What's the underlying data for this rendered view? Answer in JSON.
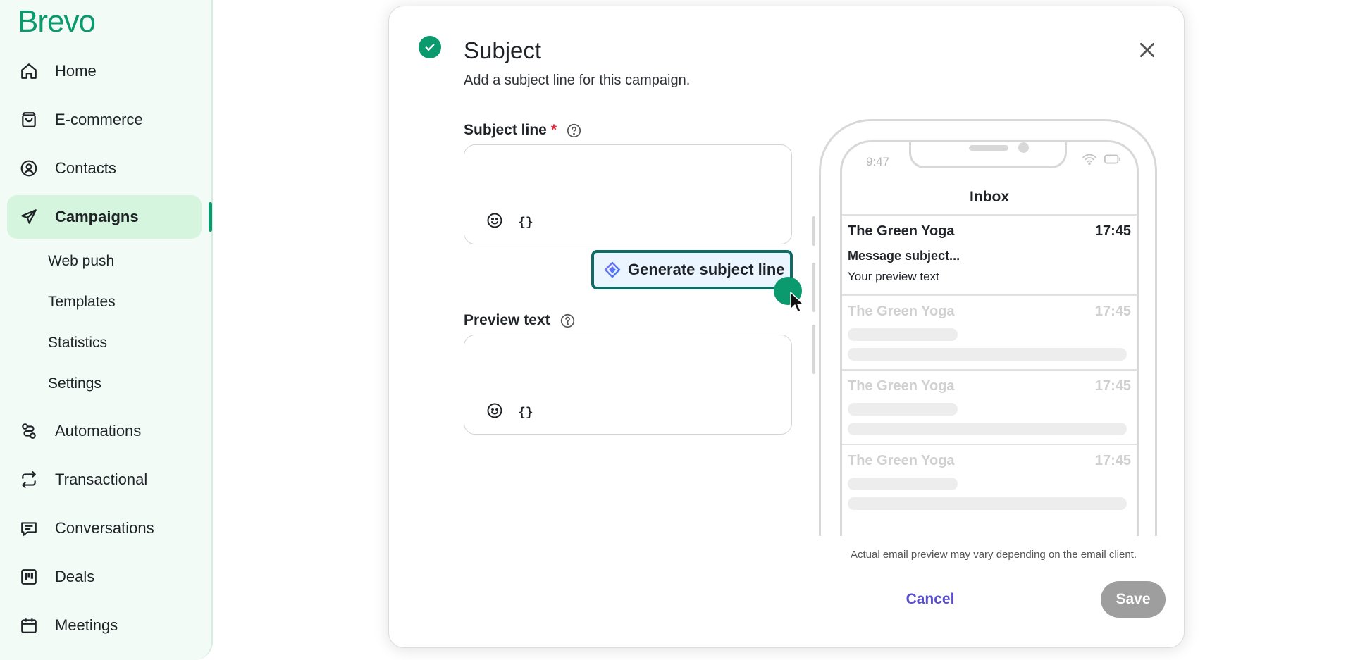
{
  "app": {
    "logo_text": "Brevo",
    "brand_color": "#0b996e"
  },
  "sidebar": {
    "items": [
      {
        "label": "Home",
        "icon": "home-icon"
      },
      {
        "label": "E-commerce",
        "icon": "shopping-bag-icon"
      },
      {
        "label": "Contacts",
        "icon": "contact-icon"
      },
      {
        "label": "Campaigns",
        "icon": "send-icon",
        "active": true
      },
      {
        "label": "Automations",
        "icon": "automation-icon"
      },
      {
        "label": "Transactional",
        "icon": "transactional-icon"
      },
      {
        "label": "Conversations",
        "icon": "conversations-icon"
      },
      {
        "label": "Deals",
        "icon": "deals-icon"
      },
      {
        "label": "Meetings",
        "icon": "calendar-icon"
      }
    ],
    "campaign_subitems": [
      "Web push",
      "Templates",
      "Statistics",
      "Settings"
    ]
  },
  "modal": {
    "title": "Subject",
    "subtitle": "Add a subject line for this campaign.",
    "subject_field": {
      "label": "Subject line",
      "required_marker": "*",
      "value": "",
      "variable_token": "{}"
    },
    "generate_button_label": "Generate subject line",
    "preview_field": {
      "label": "Preview text",
      "value": "",
      "variable_token": "{}"
    },
    "phone": {
      "status_time": "9:47",
      "inbox_title": "Inbox",
      "messages": [
        {
          "sender": "The Green Yoga",
          "time": "17:45",
          "subject": "Message subject...",
          "preview": "Your preview text"
        },
        {
          "sender": "The Green Yoga",
          "time": "17:45"
        },
        {
          "sender": "The Green Yoga",
          "time": "17:45"
        },
        {
          "sender": "The Green Yoga",
          "time": "17:45"
        }
      ]
    },
    "disclaimer": "Actual email preview may vary depending on the email client.",
    "cancel_label": "Cancel",
    "save_label": "Save"
  }
}
